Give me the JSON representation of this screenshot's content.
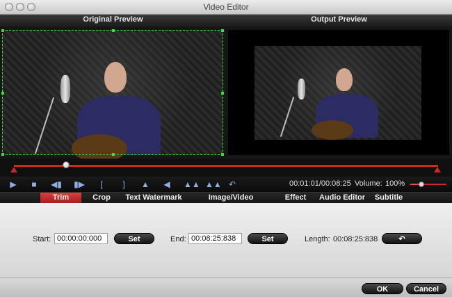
{
  "window": {
    "title": "Video Editor"
  },
  "preview": {
    "original_label": "Original Preview",
    "output_label": "Output Preview"
  },
  "playback": {
    "position_fraction": 0.123,
    "time": "00:01:01/00:08:25",
    "volume_label": "Volume:",
    "volume_value": "100%",
    "volume_fraction": 0.3
  },
  "controls": {
    "play_icon": "play-icon",
    "stop_icon": "stop-icon",
    "prev_frame_icon": "previous-frame-icon",
    "next_frame_icon": "next-frame-icon",
    "mark_in_icon": "mark-in-icon",
    "mark_out_icon": "mark-out-icon",
    "flip_h_icon": "flip-horizontal-icon",
    "flip_v_icon": "flip-vertical-icon",
    "rotate_left_icon": "rotate-left-icon",
    "rotate_right_icon": "rotate-right-icon",
    "undo_icon": "undo-icon"
  },
  "tabs": [
    {
      "label": "Trim",
      "active": true
    },
    {
      "label": "Crop"
    },
    {
      "label": "Text Watermark"
    },
    {
      "label": "Image/Video Watermark"
    },
    {
      "label": "Effect"
    },
    {
      "label": "Audio Editor"
    },
    {
      "label": "Subtitle"
    }
  ],
  "trim": {
    "start_label": "Start:",
    "start_value": "00:00:00:000",
    "end_label": "End:",
    "end_value": "00:08:25:838",
    "set_label": "Set",
    "length_label": "Length:",
    "length_value": "00:08:25:838"
  },
  "footer": {
    "ok_label": "OK",
    "cancel_label": "Cancel"
  },
  "colors": {
    "accent": "#c82a2a",
    "crop_frame": "#38e038",
    "icon": "#8fb0e0"
  }
}
